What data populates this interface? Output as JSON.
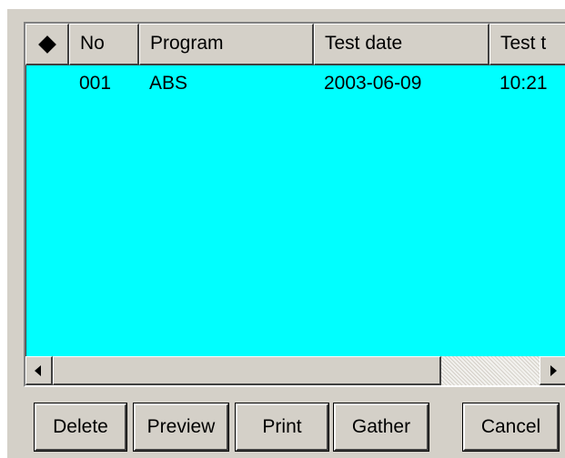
{
  "table": {
    "headers": {
      "no": "No",
      "program": "Program",
      "test_date": "Test date",
      "test_time": "Test t"
    },
    "rows": [
      {
        "no": "001",
        "program": "ABS",
        "test_date": "2003-06-09",
        "test_time": "10:21"
      }
    ],
    "selection_icon": "diamond-icon",
    "row_highlight_color": "#00ffff"
  },
  "scrollbar": {
    "left_icon": "arrow-left-icon",
    "right_icon": "arrow-right-icon"
  },
  "buttons": {
    "delete": "Delete",
    "preview": "Preview",
    "print": "Print",
    "gather": "Gather",
    "cancel": "Cancel"
  },
  "colors": {
    "dialog_bg": "#d4d0c8",
    "grid_bg": "#00ffff"
  }
}
